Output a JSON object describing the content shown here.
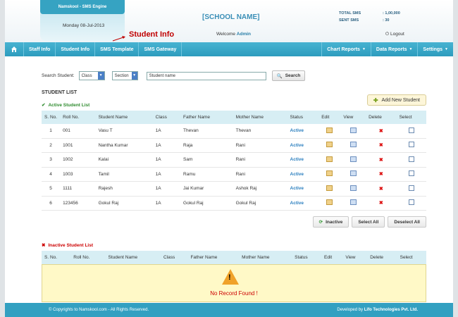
{
  "header": {
    "brand": "Namskool - SMS Engine",
    "date": "Monday 08-Jul-2013",
    "annotation": "Student Info",
    "school_name": "[SCHOOL NAME]",
    "welcome_prefix": "Welcome",
    "welcome_user": "Admin",
    "total_sms_label": "TOTAL SMS",
    "total_sms_value": ": 1,00,000",
    "sent_sms_label": "SENT SMS",
    "sent_sms_value": ": 30",
    "logout": "Logout"
  },
  "nav": {
    "items": [
      "Staff Info",
      "Student Info",
      "SMS Template",
      "SMS Gateway"
    ],
    "right": [
      "Chart Reports",
      "Data Reports",
      "Settings"
    ]
  },
  "search": {
    "label": "Search Student:",
    "class_value": "Class",
    "section_value": "Section",
    "name_value": "Student name",
    "button": "Search"
  },
  "student_list": {
    "title": "STUDENT LIST",
    "active_label": "Active Student List",
    "add_button": "Add New Student",
    "columns": [
      "S. No.",
      "Roll No.",
      "Student Name",
      "Class",
      "Father Name",
      "Mother Name",
      "Status",
      "Edit",
      "View",
      "Delete",
      "Select"
    ],
    "rows": [
      [
        "1",
        "001",
        "Vasu T",
        "1A",
        "Thevan",
        "Thevan",
        "Active"
      ],
      [
        "2",
        "1001",
        "Nantha Kumar",
        "1A",
        "Raja",
        "Rani",
        "Active"
      ],
      [
        "3",
        "1002",
        "Kalai",
        "1A",
        "Sam",
        "Rani",
        "Active"
      ],
      [
        "4",
        "1003",
        "Tamil",
        "1A",
        "Ramu",
        "Rani",
        "Active"
      ],
      [
        "5",
        "1111",
        "Rajesh",
        "1A",
        "Jai Kumar",
        "Ashok Raj",
        "Active"
      ],
      [
        "6",
        "123456",
        "Gokul Raj",
        "1A",
        "Gokul Raj",
        "Gokul Raj",
        "Active"
      ]
    ],
    "inactive_button": "Inactive",
    "select_all": "Select All",
    "deselect_all": "Deselect All"
  },
  "inactive_list": {
    "label": "Inactive Student List",
    "no_record": "No Record Found !"
  },
  "footer": {
    "left": "© Copyrights to Namskool.com - All Rights Reserved.",
    "right_prefix": "Developed by",
    "right_company": "Lifo Technologies Pvt. Ltd."
  }
}
